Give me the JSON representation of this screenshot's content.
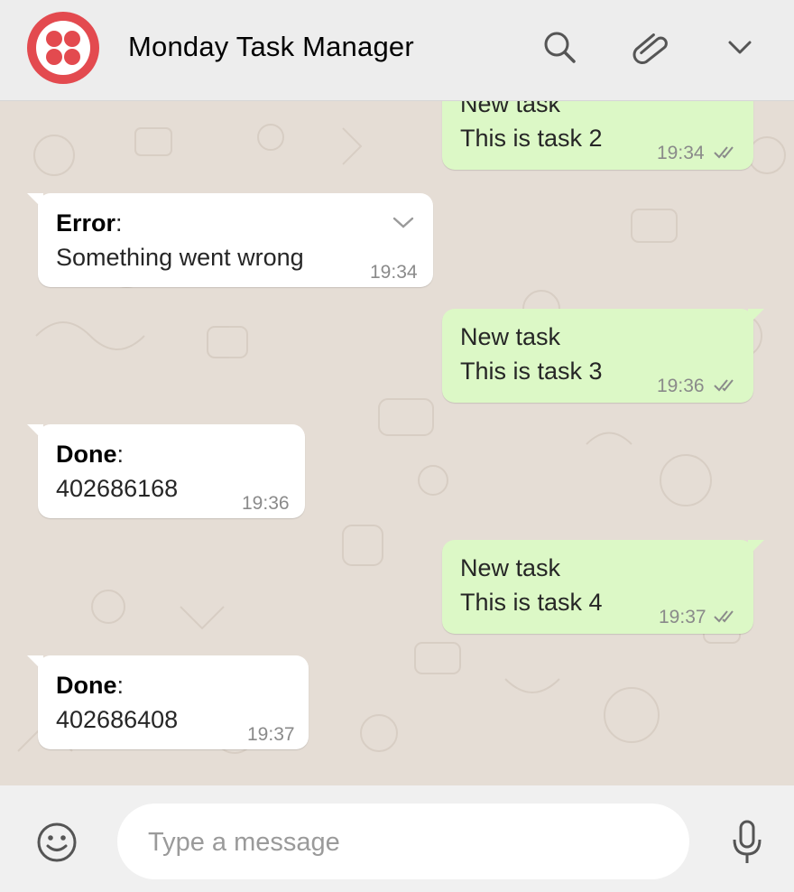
{
  "header": {
    "title": "Monday Task Manager",
    "brand_color": "#e34a4f",
    "icons": [
      "search-icon",
      "paperclip-icon",
      "chevron-down-icon"
    ]
  },
  "messages": [
    {
      "direction": "out",
      "line1": "New task",
      "line2": "This is task 2",
      "time": "19:34",
      "status": "read"
    },
    {
      "direction": "in",
      "label": "Error",
      "line2": "Something went wrong",
      "time": "19:34"
    },
    {
      "direction": "out",
      "line1": "New task",
      "line2": "This is task 3",
      "time": "19:36",
      "status": "read"
    },
    {
      "direction": "in",
      "label": "Done",
      "line2": "402686168",
      "time": "19:36"
    },
    {
      "direction": "out",
      "line1": "New task",
      "line2": "This is task 4",
      "time": "19:37",
      "status": "read"
    },
    {
      "direction": "in",
      "label": "Done",
      "line2": "402686408",
      "time": "19:37"
    }
  ],
  "footer": {
    "placeholder": "Type a message",
    "value": "",
    "icons": [
      "emoji-icon",
      "microphone-icon"
    ]
  },
  "colors": {
    "outgoing_bubble": "#dcf8c6",
    "incoming_bubble": "#ffffff",
    "chat_background": "#e5ddd5"
  }
}
